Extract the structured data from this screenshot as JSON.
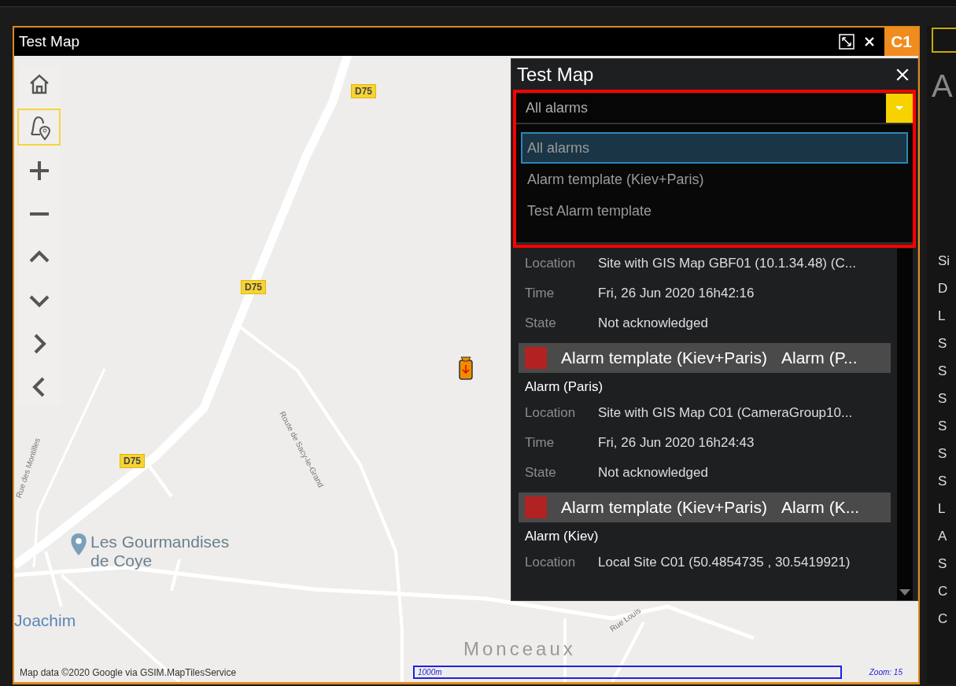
{
  "window": {
    "title": "Test Map",
    "badge": "C1"
  },
  "map_toolbar": [
    {
      "kind": "home",
      "selected": false
    },
    {
      "kind": "alarm-pin",
      "selected": true
    },
    {
      "kind": "zoom-in",
      "selected": false
    },
    {
      "kind": "zoom-out",
      "selected": false
    },
    {
      "kind": "up",
      "selected": false
    },
    {
      "kind": "down",
      "selected": false
    },
    {
      "kind": "right",
      "selected": false
    },
    {
      "kind": "left",
      "selected": false
    }
  ],
  "map": {
    "road_badges": [
      "D75",
      "D75",
      "D75"
    ],
    "places": [
      {
        "kind": "poi",
        "text": "Les Gourmandises de Coye"
      },
      {
        "kind": "area",
        "text": "Joachim"
      },
      {
        "kind": "town",
        "text": "Monceaux"
      }
    ],
    "streets": [
      "Route de Sacy-le-Grand",
      "Rue des Montilles",
      "Rue Louis"
    ],
    "attribution": "Map data ©2020 Google via GSIM.MapTilesService",
    "scale": "1000m",
    "zoom": "Zoom: 15"
  },
  "alarm_panel": {
    "title": "Test Map",
    "filter": {
      "value": "All alarms",
      "options": [
        {
          "label": "All alarms",
          "selected": true
        },
        {
          "label": "Alarm template (Kiev+Paris)",
          "selected": false
        },
        {
          "label": "Test Alarm template",
          "selected": false
        }
      ]
    },
    "alarms": [
      {
        "fields": [
          {
            "label": "Location",
            "value": "Site with GIS Map GBF01 (10.1.34.48) (C..."
          },
          {
            "label": "Time",
            "value": "Fri, 26 Jun 2020  16h42:16"
          },
          {
            "label": "State",
            "value": "Not acknowledged"
          }
        ]
      },
      {
        "color": "#b22222",
        "template": "Alarm template (Kiev+Paris)",
        "name": "Alarm (P...",
        "subtitle": "Alarm (Paris)",
        "fields": [
          {
            "label": "Location",
            "value": "Site with GIS Map C01 (CameraGroup10..."
          },
          {
            "label": "Time",
            "value": "Fri, 26 Jun 2020  16h24:43"
          },
          {
            "label": "State",
            "value": "Not acknowledged"
          }
        ]
      },
      {
        "color": "#b22222",
        "template": "Alarm template (Kiev+Paris)",
        "name": "Alarm (K...",
        "subtitle": "Alarm (Kiev)",
        "fields": [
          {
            "label": "Location",
            "value": "Local Site C01 (50.4854735 , 30.5419921)"
          }
        ]
      }
    ]
  },
  "right_panel": {
    "heading": "A",
    "items": [
      "Si",
      "D",
      "L",
      "S",
      "S",
      "S",
      "S",
      "S",
      "S",
      "L",
      "A",
      "S",
      "C",
      "C"
    ]
  }
}
